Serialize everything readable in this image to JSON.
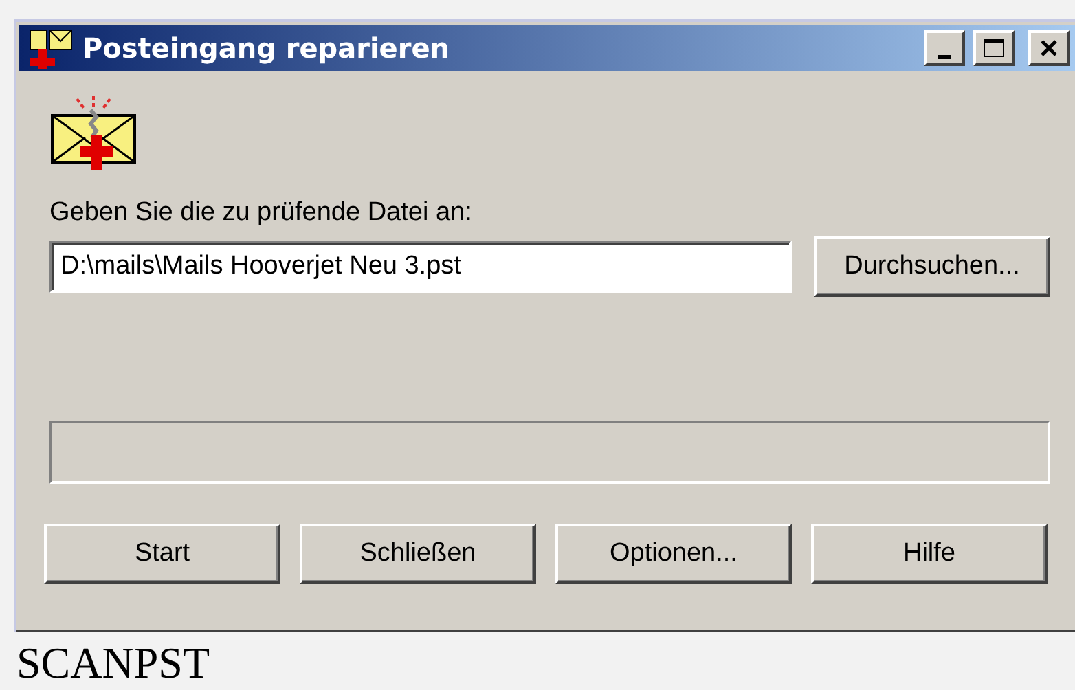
{
  "window": {
    "title": "Posteingang reparieren",
    "controls": [
      {
        "kind": "minimize"
      },
      {
        "kind": "maximize"
      },
      {
        "kind": "close"
      }
    ]
  },
  "file_label": {
    "text": "Geben Sie die zu prüfende Datei an:"
  },
  "file_field": {
    "value": "D:\\mails\\Mails Hooverjet Neu 3.pst"
  },
  "browse_button": {
    "label": "Durchsuchen..."
  },
  "buttons": [
    {
      "label": "Start"
    },
    {
      "label": "Schließen"
    },
    {
      "label": "Optionen..."
    },
    {
      "label": "Hilfe"
    }
  ],
  "caption": "SCANPST"
}
